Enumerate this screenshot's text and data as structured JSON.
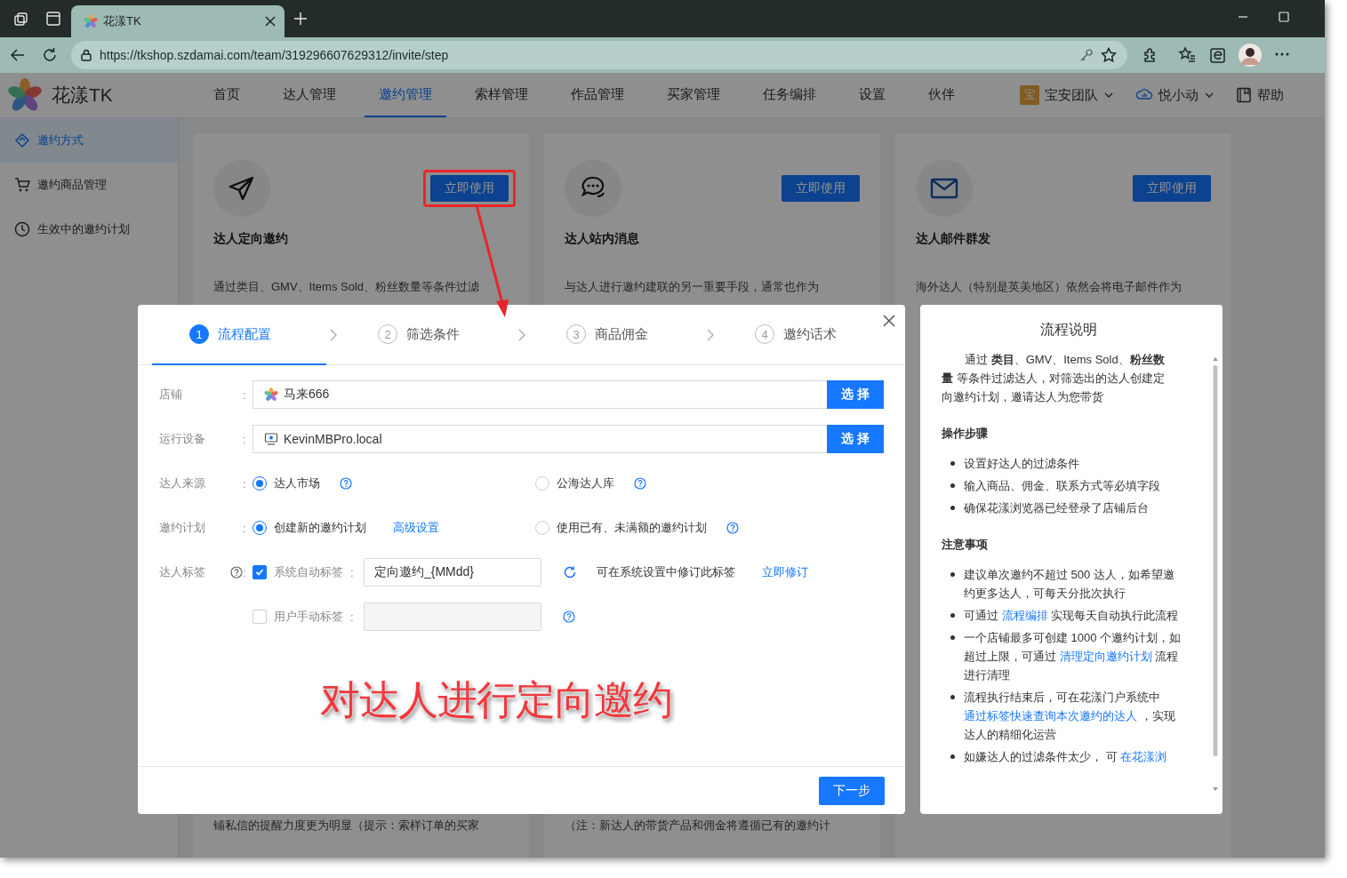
{
  "browser": {
    "tab_title": "花漾TK",
    "url": "https://tkshop.szdamai.com/team/319296607629312/invite/step"
  },
  "header": {
    "logo": "花漾TK",
    "nav": [
      {
        "label": "首页",
        "selected": false
      },
      {
        "label": "达人管理",
        "selected": false
      },
      {
        "label": "邀约管理",
        "selected": true
      },
      {
        "label": "索样管理",
        "selected": false
      },
      {
        "label": "作品管理",
        "selected": false
      },
      {
        "label": "买家管理",
        "selected": false
      },
      {
        "label": "任务编排",
        "selected": false
      },
      {
        "label": "设置",
        "selected": false
      },
      {
        "label": "伙伴",
        "selected": false
      }
    ],
    "team_badge": "宝",
    "team": "宝安团队",
    "user": "悦小动",
    "help": "帮助"
  },
  "sidebar": {
    "items": [
      {
        "label": "邀约方式",
        "selected": true
      },
      {
        "label": "邀约商品管理",
        "selected": false
      },
      {
        "label": "生效中的邀约计划",
        "selected": false
      }
    ]
  },
  "cards": [
    {
      "title": "达人定向邀约",
      "button": "立即使用",
      "description": "通过类目、GMV、Items Sold、粉丝数量等条件过滤",
      "footer_text": "铺私信的提醒力度更为明显（提示：索样订单的买家",
      "highlighted": true
    },
    {
      "title": "达人站内消息",
      "button": "立即使用",
      "description": "与达人进行邀约建联的另一重要手段，通常也作为",
      "footer_text": "（注：新达人的带货产品和佣金将遵循已有的邀约计",
      "highlighted": false
    },
    {
      "title": "达人邮件群发",
      "button": "立即使用",
      "description": "海外达人（特别是英美地区）依然会将电子邮件作为",
      "highlighted": false
    }
  ],
  "modal": {
    "steps": [
      {
        "number": "1",
        "label": "流程配置",
        "selected": true
      },
      {
        "number": "2",
        "label": "筛选条件",
        "selected": false
      },
      {
        "number": "3",
        "label": "商品佣金",
        "selected": false
      },
      {
        "number": "4",
        "label": "邀约话术",
        "selected": false
      }
    ],
    "label_suffix": ":",
    "fields": [
      {
        "kind": "picker",
        "label": "店铺",
        "value": "马来666",
        "button": "选 择"
      },
      {
        "kind": "picker",
        "label": "运行设备",
        "value": "KevinMBPro.local",
        "button": "选 择"
      },
      {
        "kind": "radio",
        "label": "达人来源",
        "options": [
          {
            "label": "达人市场",
            "selected": true,
            "help": true
          },
          {
            "label": "公海达人库",
            "selected": false,
            "help": true
          }
        ]
      },
      {
        "kind": "radio",
        "label": "邀约计划",
        "options": [
          {
            "label": "创建新的邀约计划",
            "selected": true,
            "help": false,
            "link": "高级设置"
          },
          {
            "label": "使用已有、未满额的邀约计划",
            "selected": false,
            "help": true
          }
        ]
      },
      {
        "kind": "tags",
        "label": "达人标签",
        "help": true,
        "rows": [
          {
            "label": "系统自动标签",
            "checked": true,
            "help": false,
            "value": "定向邀约_{MMdd}",
            "note": "可在系统设置中修订此标签",
            "link": "立即修订"
          },
          {
            "label": "用户手动标签",
            "checked": false,
            "help": true
          }
        ]
      }
    ],
    "next_button": "下一步"
  },
  "annotation": {
    "caption": "对达人进行定向邀约"
  },
  "guide": {
    "title": "流程说明",
    "intro": "通过 **类目**、GMV、Items Sold、**粉丝数量** 等条件过滤达人，对筛选出的达人创建定向邀约计划，邀请达人为您带货",
    "sections": [
      {
        "heading": "操作步骤",
        "items": [
          {
            "parts": [
              {
                "text": "设置好达人的过滤条件",
                "link": false
              }
            ]
          },
          {
            "parts": [
              {
                "text": "输入商品、佣金、联系方式等必填字段",
                "link": false
              }
            ]
          },
          {
            "parts": [
              {
                "text": "确保花漾浏览器已经登录了店铺后台",
                "link": false
              }
            ]
          }
        ]
      },
      {
        "heading": "注意事项",
        "items": [
          {
            "parts": [
              {
                "text": "建议单次邀约不超过 500 达人，如希望邀约更多达人，可每天分批次执行",
                "link": false
              }
            ]
          },
          {
            "parts": [
              {
                "text": "可通过 ",
                "link": false
              },
              {
                "text": "流程编排",
                "link": true
              },
              {
                "text": " 实现每天自动执行此流程",
                "link": false
              }
            ]
          },
          {
            "parts": [
              {
                "text": "一个店铺最多可创建 1000 个邀约计划，如超过上限，可通过 ",
                "link": false
              },
              {
                "text": "清理定向邀约计划",
                "link": true
              },
              {
                "text": " 流程进行清理",
                "link": false
              }
            ]
          },
          {
            "parts": [
              {
                "text": "流程执行结束后，可在花漾门户系统中",
                "link": false
              },
              {
                "text": "通过标签快速查询本次邀约的达人",
                "link": true
              },
              {
                "text": " ，实现达人的精细化运营",
                "link": false
              }
            ]
          },
          {
            "parts": [
              {
                "text": "如嫌达人的过滤条件太少， 可 ",
                "link": false
              },
              {
                "text": "在花漾浏",
                "link": true
              }
            ]
          }
        ]
      }
    ]
  }
}
